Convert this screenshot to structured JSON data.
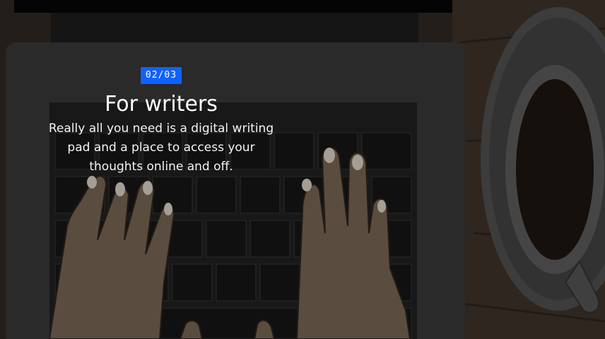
{
  "slide": {
    "counter": "02/03",
    "title": "For writers",
    "description": "Really all you need is a digital writing pad and a place to access your thoughts online and off."
  },
  "colors": {
    "accent": "#0f62fe",
    "text": "#f4f4f4",
    "background": "#161616"
  }
}
